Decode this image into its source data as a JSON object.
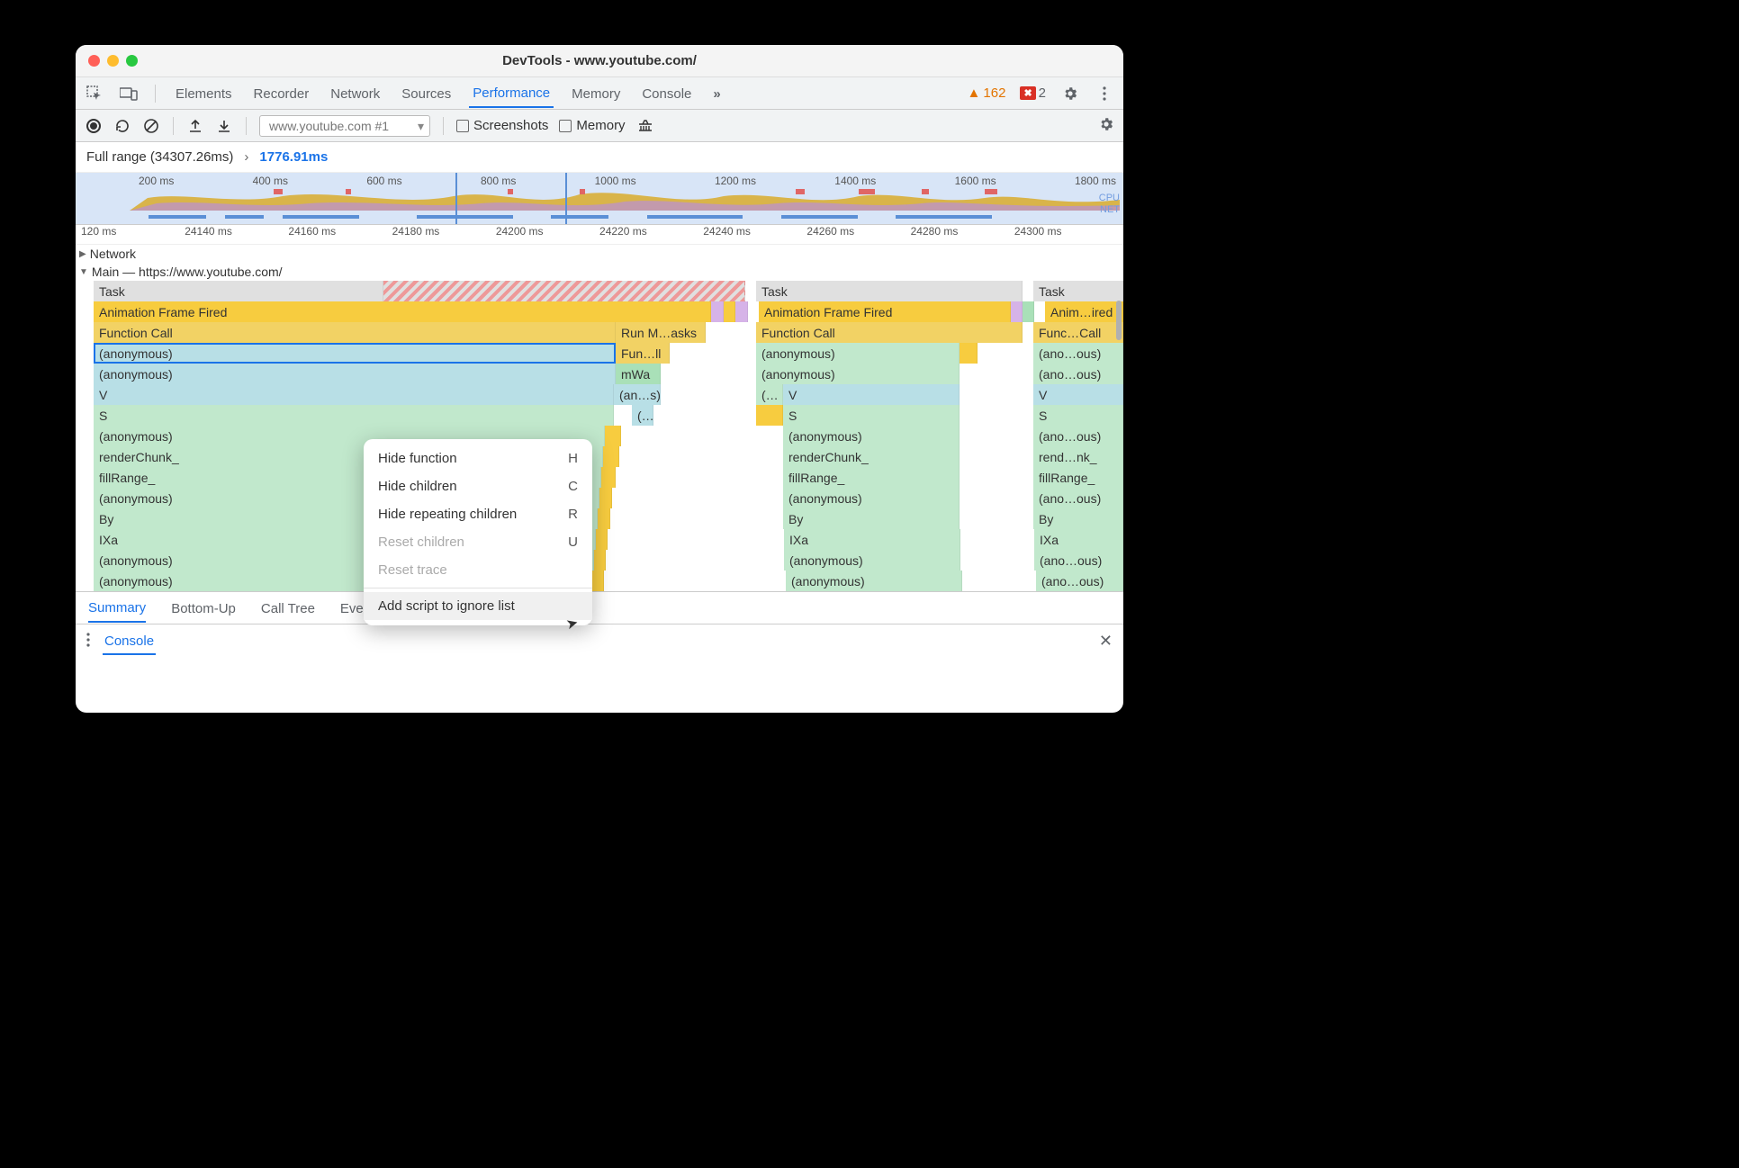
{
  "window": {
    "title": "DevTools - www.youtube.com/"
  },
  "tabs": {
    "items": [
      "Elements",
      "Recorder",
      "Network",
      "Sources",
      "Performance",
      "Memory",
      "Console"
    ],
    "active": "Performance",
    "overflow_glyph": "»",
    "warn_count": "162",
    "error_count": "2"
  },
  "toolbar": {
    "profile_select": "www.youtube.com #1",
    "checkbox_screenshots": "Screenshots",
    "checkbox_memory": "Memory"
  },
  "range": {
    "full_label": "Full range (34307.26ms)",
    "selected": "1776.91ms"
  },
  "overview": {
    "ticks": [
      "200 ms",
      "400 ms",
      "600 ms",
      "800 ms",
      "1000 ms",
      "1200 ms",
      "1400 ms",
      "1600 ms",
      "1800 ms"
    ],
    "labels": [
      "CPU",
      "NET"
    ]
  },
  "ruler": {
    "ticks": [
      "120 ms",
      "24140 ms",
      "24160 ms",
      "24180 ms",
      "24200 ms",
      "24220 ms",
      "24240 ms",
      "24260 ms",
      "24280 ms",
      "24300 ms"
    ]
  },
  "tracks": {
    "network_label": "Network",
    "main_label": "Main — https://www.youtube.com/"
  },
  "flame": {
    "col1": [
      "Task",
      "Animation Frame Fired",
      "Function Call",
      "(anonymous)",
      "(anonymous)",
      "V",
      "S",
      "(anonymous)",
      "renderChunk_",
      "fillRange_",
      "(anonymous)",
      "By",
      "IXa",
      "(anonymous)",
      "(anonymous)"
    ],
    "col1b": [
      "Run M…asks",
      "Fun…ll",
      "mWa",
      "(an…s)",
      "(…"
    ],
    "col2": [
      "Task",
      "Animation Frame Fired",
      "Function Call",
      "(anonymous)",
      "(anonymous)",
      "V",
      "S",
      "(anonymous)",
      "renderChunk_",
      "fillRange_",
      "(anonymous)",
      "By",
      "IXa",
      "(anonymous)",
      "(anonymous)"
    ],
    "col2_prefix": "(…",
    "col3": [
      "Task",
      "Anim…ired",
      "Func…Call",
      "(ano…ous)",
      "(ano…ous)",
      "V",
      "S",
      "(ano…ous)",
      "rend…nk_",
      "fillRange_",
      "(ano…ous)",
      "By",
      "IXa",
      "(ano…ous)",
      "(ano…ous)"
    ]
  },
  "context_menu": {
    "items": [
      {
        "label": "Hide function",
        "key": "H",
        "disabled": false
      },
      {
        "label": "Hide children",
        "key": "C",
        "disabled": false
      },
      {
        "label": "Hide repeating children",
        "key": "R",
        "disabled": false
      },
      {
        "label": "Reset children",
        "key": "U",
        "disabled": true
      },
      {
        "label": "Reset trace",
        "key": "",
        "disabled": true
      },
      {
        "label": "Add script to ignore list",
        "key": "",
        "disabled": false,
        "hover": true
      }
    ]
  },
  "bottom_tabs": {
    "items": [
      "Summary",
      "Bottom-Up",
      "Call Tree",
      "Event Log"
    ],
    "active": "Summary"
  },
  "console": {
    "label": "Console"
  }
}
